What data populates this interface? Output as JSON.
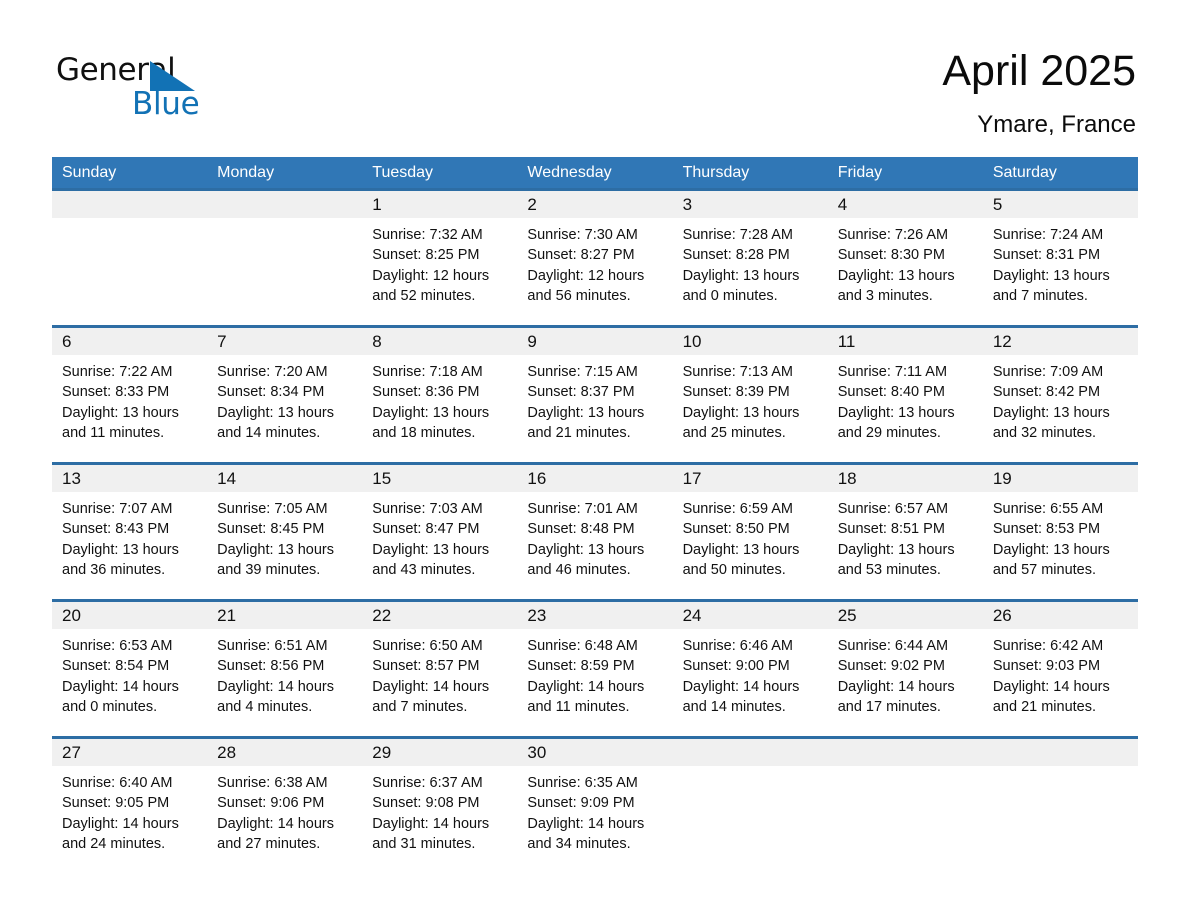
{
  "brand": {
    "name_part1": "General",
    "name_part2": "Blue",
    "accent_color": "#1272b5"
  },
  "header": {
    "title": "April 2025",
    "location": "Ymare, France"
  },
  "calendar": {
    "header_bg": "#3077b6",
    "weekday_headers": [
      "Sunday",
      "Monday",
      "Tuesday",
      "Wednesday",
      "Thursday",
      "Friday",
      "Saturday"
    ],
    "weeks": [
      {
        "days": [
          {
            "num": "",
            "sunrise": "",
            "sunset": "",
            "daylight_line1": "",
            "daylight_line2": ""
          },
          {
            "num": "",
            "sunrise": "",
            "sunset": "",
            "daylight_line1": "",
            "daylight_line2": ""
          },
          {
            "num": "1",
            "sunrise": "Sunrise: 7:32 AM",
            "sunset": "Sunset: 8:25 PM",
            "daylight_line1": "Daylight: 12 hours",
            "daylight_line2": "and 52 minutes."
          },
          {
            "num": "2",
            "sunrise": "Sunrise: 7:30 AM",
            "sunset": "Sunset: 8:27 PM",
            "daylight_line1": "Daylight: 12 hours",
            "daylight_line2": "and 56 minutes."
          },
          {
            "num": "3",
            "sunrise": "Sunrise: 7:28 AM",
            "sunset": "Sunset: 8:28 PM",
            "daylight_line1": "Daylight: 13 hours",
            "daylight_line2": "and 0 minutes."
          },
          {
            "num": "4",
            "sunrise": "Sunrise: 7:26 AM",
            "sunset": "Sunset: 8:30 PM",
            "daylight_line1": "Daylight: 13 hours",
            "daylight_line2": "and 3 minutes."
          },
          {
            "num": "5",
            "sunrise": "Sunrise: 7:24 AM",
            "sunset": "Sunset: 8:31 PM",
            "daylight_line1": "Daylight: 13 hours",
            "daylight_line2": "and 7 minutes."
          }
        ]
      },
      {
        "days": [
          {
            "num": "6",
            "sunrise": "Sunrise: 7:22 AM",
            "sunset": "Sunset: 8:33 PM",
            "daylight_line1": "Daylight: 13 hours",
            "daylight_line2": "and 11 minutes."
          },
          {
            "num": "7",
            "sunrise": "Sunrise: 7:20 AM",
            "sunset": "Sunset: 8:34 PM",
            "daylight_line1": "Daylight: 13 hours",
            "daylight_line2": "and 14 minutes."
          },
          {
            "num": "8",
            "sunrise": "Sunrise: 7:18 AM",
            "sunset": "Sunset: 8:36 PM",
            "daylight_line1": "Daylight: 13 hours",
            "daylight_line2": "and 18 minutes."
          },
          {
            "num": "9",
            "sunrise": "Sunrise: 7:15 AM",
            "sunset": "Sunset: 8:37 PM",
            "daylight_line1": "Daylight: 13 hours",
            "daylight_line2": "and 21 minutes."
          },
          {
            "num": "10",
            "sunrise": "Sunrise: 7:13 AM",
            "sunset": "Sunset: 8:39 PM",
            "daylight_line1": "Daylight: 13 hours",
            "daylight_line2": "and 25 minutes."
          },
          {
            "num": "11",
            "sunrise": "Sunrise: 7:11 AM",
            "sunset": "Sunset: 8:40 PM",
            "daylight_line1": "Daylight: 13 hours",
            "daylight_line2": "and 29 minutes."
          },
          {
            "num": "12",
            "sunrise": "Sunrise: 7:09 AM",
            "sunset": "Sunset: 8:42 PM",
            "daylight_line1": "Daylight: 13 hours",
            "daylight_line2": "and 32 minutes."
          }
        ]
      },
      {
        "days": [
          {
            "num": "13",
            "sunrise": "Sunrise: 7:07 AM",
            "sunset": "Sunset: 8:43 PM",
            "daylight_line1": "Daylight: 13 hours",
            "daylight_line2": "and 36 minutes."
          },
          {
            "num": "14",
            "sunrise": "Sunrise: 7:05 AM",
            "sunset": "Sunset: 8:45 PM",
            "daylight_line1": "Daylight: 13 hours",
            "daylight_line2": "and 39 minutes."
          },
          {
            "num": "15",
            "sunrise": "Sunrise: 7:03 AM",
            "sunset": "Sunset: 8:47 PM",
            "daylight_line1": "Daylight: 13 hours",
            "daylight_line2": "and 43 minutes."
          },
          {
            "num": "16",
            "sunrise": "Sunrise: 7:01 AM",
            "sunset": "Sunset: 8:48 PM",
            "daylight_line1": "Daylight: 13 hours",
            "daylight_line2": "and 46 minutes."
          },
          {
            "num": "17",
            "sunrise": "Sunrise: 6:59 AM",
            "sunset": "Sunset: 8:50 PM",
            "daylight_line1": "Daylight: 13 hours",
            "daylight_line2": "and 50 minutes."
          },
          {
            "num": "18",
            "sunrise": "Sunrise: 6:57 AM",
            "sunset": "Sunset: 8:51 PM",
            "daylight_line1": "Daylight: 13 hours",
            "daylight_line2": "and 53 minutes."
          },
          {
            "num": "19",
            "sunrise": "Sunrise: 6:55 AM",
            "sunset": "Sunset: 8:53 PM",
            "daylight_line1": "Daylight: 13 hours",
            "daylight_line2": "and 57 minutes."
          }
        ]
      },
      {
        "days": [
          {
            "num": "20",
            "sunrise": "Sunrise: 6:53 AM",
            "sunset": "Sunset: 8:54 PM",
            "daylight_line1": "Daylight: 14 hours",
            "daylight_line2": "and 0 minutes."
          },
          {
            "num": "21",
            "sunrise": "Sunrise: 6:51 AM",
            "sunset": "Sunset: 8:56 PM",
            "daylight_line1": "Daylight: 14 hours",
            "daylight_line2": "and 4 minutes."
          },
          {
            "num": "22",
            "sunrise": "Sunrise: 6:50 AM",
            "sunset": "Sunset: 8:57 PM",
            "daylight_line1": "Daylight: 14 hours",
            "daylight_line2": "and 7 minutes."
          },
          {
            "num": "23",
            "sunrise": "Sunrise: 6:48 AM",
            "sunset": "Sunset: 8:59 PM",
            "daylight_line1": "Daylight: 14 hours",
            "daylight_line2": "and 11 minutes."
          },
          {
            "num": "24",
            "sunrise": "Sunrise: 6:46 AM",
            "sunset": "Sunset: 9:00 PM",
            "daylight_line1": "Daylight: 14 hours",
            "daylight_line2": "and 14 minutes."
          },
          {
            "num": "25",
            "sunrise": "Sunrise: 6:44 AM",
            "sunset": "Sunset: 9:02 PM",
            "daylight_line1": "Daylight: 14 hours",
            "daylight_line2": "and 17 minutes."
          },
          {
            "num": "26",
            "sunrise": "Sunrise: 6:42 AM",
            "sunset": "Sunset: 9:03 PM",
            "daylight_line1": "Daylight: 14 hours",
            "daylight_line2": "and 21 minutes."
          }
        ]
      },
      {
        "days": [
          {
            "num": "27",
            "sunrise": "Sunrise: 6:40 AM",
            "sunset": "Sunset: 9:05 PM",
            "daylight_line1": "Daylight: 14 hours",
            "daylight_line2": "and 24 minutes."
          },
          {
            "num": "28",
            "sunrise": "Sunrise: 6:38 AM",
            "sunset": "Sunset: 9:06 PM",
            "daylight_line1": "Daylight: 14 hours",
            "daylight_line2": "and 27 minutes."
          },
          {
            "num": "29",
            "sunrise": "Sunrise: 6:37 AM",
            "sunset": "Sunset: 9:08 PM",
            "daylight_line1": "Daylight: 14 hours",
            "daylight_line2": "and 31 minutes."
          },
          {
            "num": "30",
            "sunrise": "Sunrise: 6:35 AM",
            "sunset": "Sunset: 9:09 PM",
            "daylight_line1": "Daylight: 14 hours",
            "daylight_line2": "and 34 minutes."
          },
          {
            "num": "",
            "sunrise": "",
            "sunset": "",
            "daylight_line1": "",
            "daylight_line2": ""
          },
          {
            "num": "",
            "sunrise": "",
            "sunset": "",
            "daylight_line1": "",
            "daylight_line2": ""
          },
          {
            "num": "",
            "sunrise": "",
            "sunset": "",
            "daylight_line1": "",
            "daylight_line2": ""
          }
        ]
      }
    ]
  }
}
